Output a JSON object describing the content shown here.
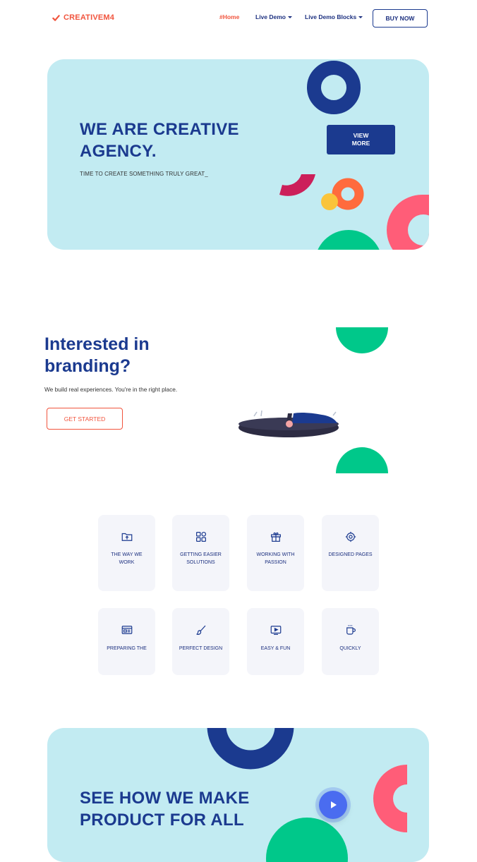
{
  "nav": {
    "logo": "CREATIVEM4",
    "links": [
      {
        "label": "#Home",
        "active": true
      },
      {
        "label": "Live Demo",
        "dropdown": true
      },
      {
        "label": "Live Demo Blocks",
        "dropdown": true
      }
    ],
    "buy_button": "BUY NOW"
  },
  "hero": {
    "title": "WE ARE CREATIVE AGENCY.",
    "subtitle": "TIME TO CREATE SOMETHING TRULY GREAT_",
    "view_button": "VIEW MORE"
  },
  "branding": {
    "title": "Interested in branding?",
    "subtitle": "We build real experiences. You're in the right place.",
    "cta": "GET STARTED"
  },
  "features": [
    {
      "label": "THE WAY WE WORK",
      "icon": "folder-upload-icon"
    },
    {
      "label": "GETTING EASIER SOLUTIONS",
      "icon": "grid-shapes-icon"
    },
    {
      "label": "WORKING WITH PASSION",
      "icon": "gift-icon"
    },
    {
      "label": "DESIGNED PAGES",
      "icon": "target-icon"
    },
    {
      "label": "PREPARING THE",
      "icon": "browser-window-icon"
    },
    {
      "label": "PERFECT DESIGN",
      "icon": "brush-icon"
    },
    {
      "label": "EASY & FUN",
      "icon": "video-icon"
    },
    {
      "label": "QUICKLY",
      "icon": "coffee-cup-icon"
    }
  ],
  "banner": {
    "title": "SEE HOW WE MAKE PRODUCT FOR ALL"
  },
  "colors": {
    "primary": "#1b3a8f",
    "accent": "#f1543d",
    "hero_bg": "#c2ebf2",
    "green": "#00c88a",
    "pink": "#ff5d78",
    "magenta": "#cc1f5a",
    "orange": "#ff6b3d",
    "yellow": "#fac43b",
    "card_bg": "#f4f5fa"
  }
}
